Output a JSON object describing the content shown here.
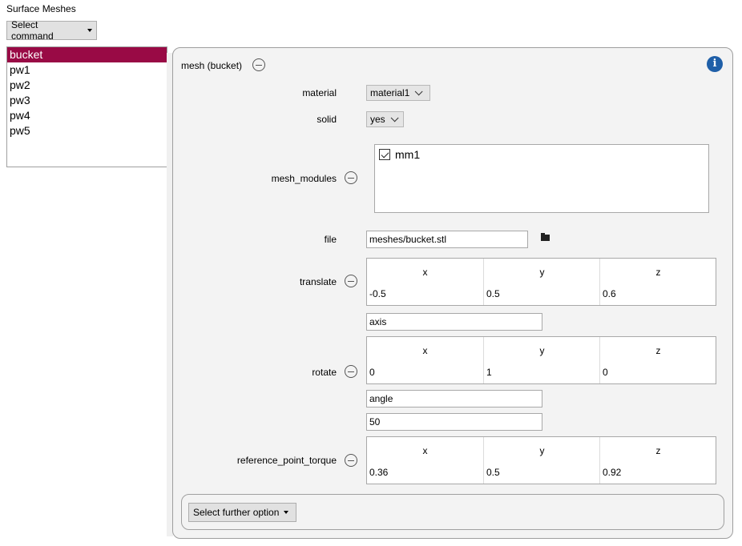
{
  "section_title": "Surface Meshes",
  "select_command": "Select command",
  "mesh_list": [
    "bucket",
    "pw1",
    "pw2",
    "pw3",
    "pw4",
    "pw5"
  ],
  "selected_mesh": "bucket",
  "panel": {
    "title": "mesh (bucket)",
    "info_icon": "info-icon",
    "material": {
      "label": "material",
      "value": "material1"
    },
    "solid": {
      "label": "solid",
      "value": "yes"
    },
    "mesh_modules": {
      "label": "mesh_modules",
      "items": [
        {
          "name": "mm1",
          "checked": true
        }
      ]
    },
    "file": {
      "label": "file",
      "value": "meshes/bucket.stl",
      "icon": "folder-icon"
    },
    "translate": {
      "label": "translate",
      "headers": [
        "x",
        "y",
        "z"
      ],
      "values": [
        "-0.5",
        "0.5",
        "0.6"
      ]
    },
    "rotate": {
      "label": "rotate",
      "axis_label": "axis",
      "headers": [
        "x",
        "y",
        "z"
      ],
      "values": [
        "0",
        "1",
        "0"
      ],
      "angle_label": "angle",
      "angle_value": "50"
    },
    "reference_point_torque": {
      "label": "reference_point_torque",
      "headers": [
        "x",
        "y",
        "z"
      ],
      "values": [
        "0.36",
        "0.5",
        "0.92"
      ]
    },
    "further_option": "Select further option"
  },
  "colors": {
    "selection": "#990a45",
    "info": "#1f5fa8",
    "panel_bg": "#f3f3f3"
  }
}
